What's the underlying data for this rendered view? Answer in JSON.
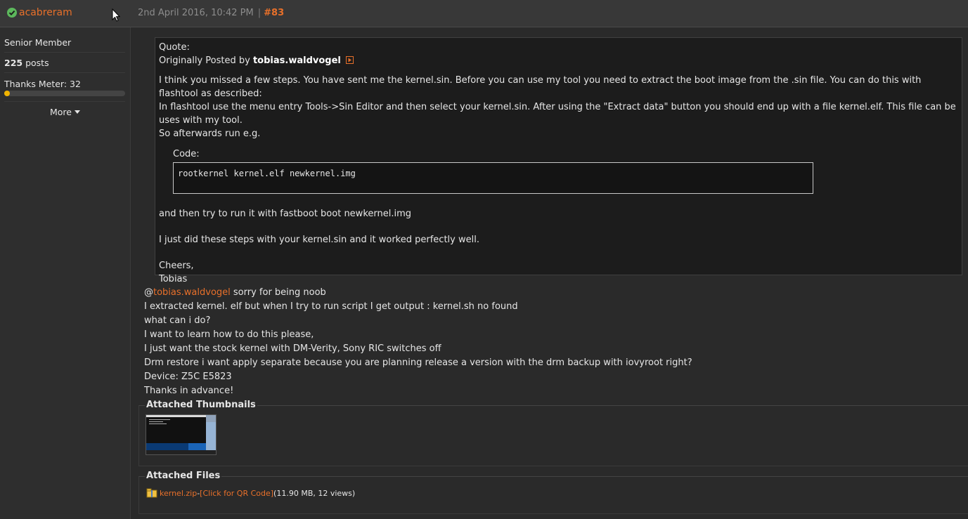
{
  "header": {
    "username": "acabreram",
    "date": "2nd April 2016, 10:42 PM",
    "separator": "|",
    "post_number": "#83"
  },
  "sidebar": {
    "rank": "Senior Member",
    "posts_count": "225",
    "posts_label": " posts",
    "thanks": "Thanks Meter: 32",
    "more_label": "More"
  },
  "quote": {
    "label": "Quote:",
    "originally_posted_by": "Originally Posted by ",
    "author": "tobias.waldvogel",
    "lines": [
      "I think you missed a few steps. You have sent me the kernel.sin. Before you can use my tool you need to extract the boot image from the .sin file. You can do this with flashtool as described:",
      "In flashtool use the menu entry Tools->Sin Editor and then select your kernel.sin. After using the \"Extract data\" button you should end up with a file kernel.elf. This file can be uses with my tool.",
      "So afterwards run e.g."
    ],
    "code_label": "Code:",
    "code": "rootkernel kernel.elf newkernel.img",
    "after_code": "and then try to run it with fastboot boot newkernel.img",
    "did_steps": "I just did these steps with your kernel.sin and it worked perfectly well.",
    "cheers": "Cheers,",
    "signature": "Tobias"
  },
  "post": {
    "at": "@",
    "mention": "tobias.waldvogel",
    "first_line_rest": " sorry for being noob",
    "lines": [
      "I extracted kernel. elf but when I try to run script I get output : kernel.sh no found",
      "what can i do?",
      "I want to learn how to do this please,",
      "I just want the stock kernel with DM-Verity, Sony RIC switches off",
      "Drm restore i want apply separate because you are planning release a version with the drm backup with iovyroot right?",
      "Device: Z5C E5823",
      "Thanks in advance!"
    ]
  },
  "attachments": {
    "thumbnails_title": "Attached Thumbnails",
    "files_title": "Attached Files",
    "file_name": "kernel.zip",
    "file_dash": " - ",
    "qr_label": "[Click for QR Code]",
    "file_meta": " (11.90 MB, 12 views)"
  },
  "colors": {
    "accent": "#e8702a",
    "online": "#5cb85c",
    "thanks_bar": "#f0b400"
  },
  "icons": {
    "online": "check-circle-icon",
    "view_post": "view-post-icon",
    "more": "caret-down-icon",
    "file": "zip-file-icon"
  }
}
